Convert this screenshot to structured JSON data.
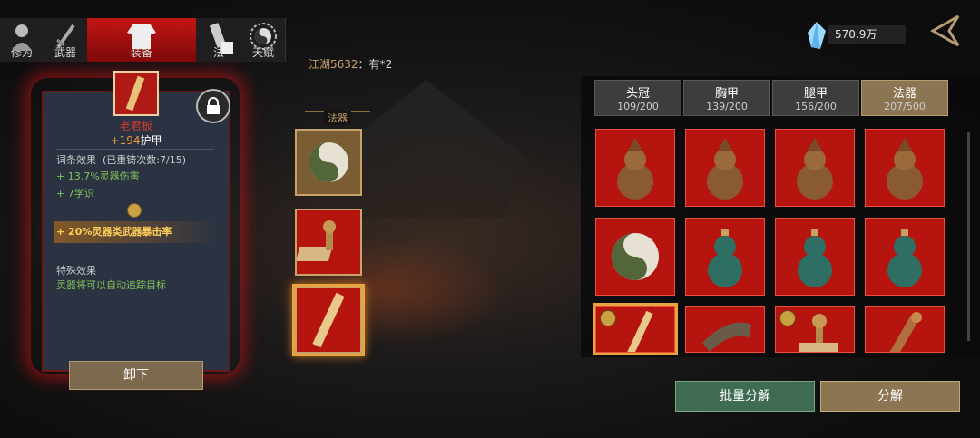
{
  "tabs": [
    {
      "label": "修为",
      "icon": "person-icon",
      "active": false
    },
    {
      "label": "武器",
      "icon": "sword-icon",
      "active": false
    },
    {
      "label": "装备",
      "icon": "robe-icon",
      "active": true
    },
    {
      "label": "法",
      "icon": "artifact-icon",
      "active": false
    },
    {
      "label": "天赋",
      "icon": "taiji-icon",
      "active": false
    }
  ],
  "currency": {
    "amount": "570.9万",
    "icon": "crystal-gem-icon"
  },
  "chat": {
    "user": "江湖5632",
    "sep": "：",
    "message": "有*2"
  },
  "detail": {
    "name": "老君板",
    "armor_value": "+194",
    "armor_label": "护甲",
    "affix_title": "词条效果",
    "recast_info": "(已重铸次数:7/15)",
    "affixes": [
      "+ 13.7%灵器伤害",
      "+ 7学识"
    ],
    "gold_affix": "+ 20%灵器类武器暴击率",
    "special_title": "特殊效果",
    "special_text": "灵器将可以自动追踪目标",
    "unequip_label": "卸下"
  },
  "middle": {
    "title": "法器"
  },
  "category_tabs": [
    {
      "name": "头冠",
      "count": "109/200",
      "active": false
    },
    {
      "name": "胸甲",
      "count": "139/200",
      "active": false
    },
    {
      "name": "腿甲",
      "count": "156/200",
      "active": false
    },
    {
      "name": "法器",
      "count": "207/500",
      "active": true
    }
  ],
  "buttons": {
    "batch_decompose": "批量分解",
    "decompose": "分解"
  },
  "colors": {
    "accent_red": "#b6150f",
    "gold": "#c9a26b",
    "green_btn": "#3f6b52",
    "tan_btn": "#8b7552"
  }
}
